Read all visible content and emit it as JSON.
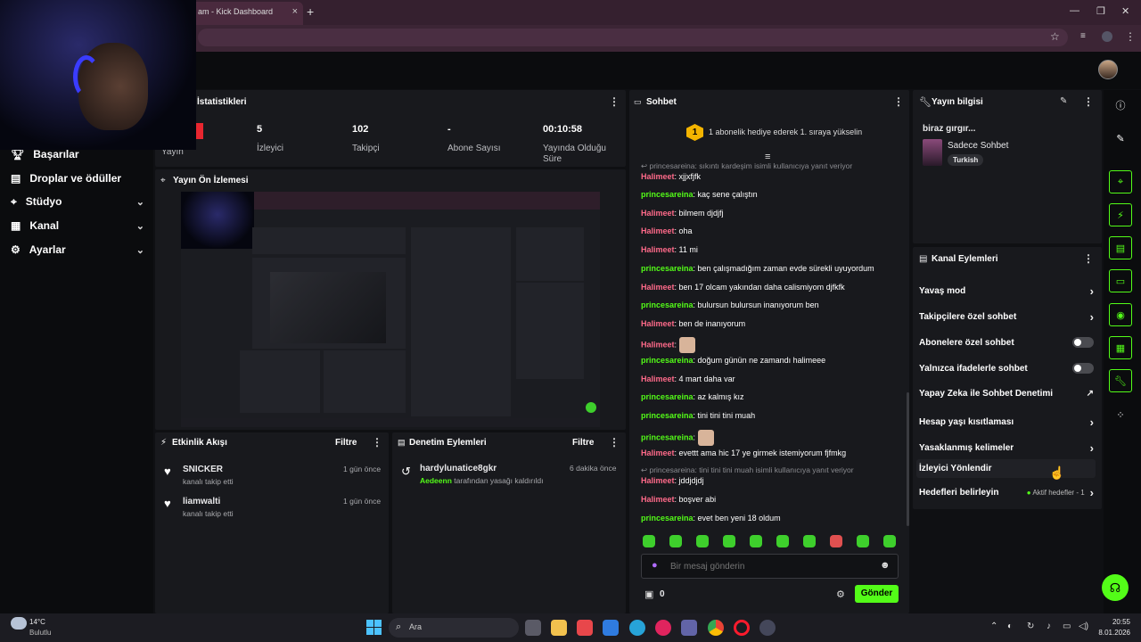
{
  "browser": {
    "tab_title": "am - Kick Dashboard",
    "tab_close": "×",
    "new_tab": "+"
  },
  "sidebar": {
    "items": [
      {
        "label": "Başarılar",
        "icon": "trophy-icon"
      },
      {
        "label": "Droplar ve ödüller",
        "icon": "gift-icon"
      },
      {
        "label": "Stüdyo",
        "icon": "studio-icon",
        "chevron": "⌄"
      },
      {
        "label": "Kanal",
        "icon": "channel-icon",
        "chevron": "⌄"
      },
      {
        "label": "Ayarlar",
        "icon": "gear-icon",
        "chevron": "⌄"
      }
    ]
  },
  "stats": {
    "title": "İstatistikleri",
    "live_label": "Yayın",
    "items": [
      {
        "value": "5",
        "label": "İzleyici"
      },
      {
        "value": "102",
        "label": "Takipçi"
      },
      {
        "value": "-",
        "label": "Abone Sayısı"
      },
      {
        "value": "00:10:58",
        "label": "Yayında Olduğu Süre"
      }
    ]
  },
  "preview": {
    "title": "Yayın Ön İzlemesi"
  },
  "activity": {
    "title": "Etkinlik Akışı",
    "filter": "Filtre",
    "items": [
      {
        "user": "SNICKER",
        "desc": "kanalı takip etti",
        "time": "1 gün önce"
      },
      {
        "user": "liamwalti",
        "desc": "kanalı takip etti",
        "time": "1 gün önce"
      }
    ]
  },
  "moderation": {
    "title": "Denetim Eylemleri",
    "filter": "Filtre",
    "items": [
      {
        "user": "hardylunatice8gkr",
        "actor": "Aedeenn",
        "desc": "tarafından yasağı kaldırıldı",
        "time": "6 dakika önce"
      }
    ]
  },
  "chat": {
    "title": "Sohbet",
    "banner_rank": "1",
    "banner": "1 abonelik hediye ederek 1. sıraya yükselin",
    "reply1": "princesareina: sıkıntı kardeşim isimli kullanıcıya yanıt veriyor",
    "reply2": "princesareina: tini tini tini muah isimli kullanıcıya yanıt veriyor",
    "messages": [
      {
        "user": "Halimeet",
        "text": "xjjxfjfk"
      },
      {
        "user": "princesareina",
        "text": "kaç sene çalıştın"
      },
      {
        "user": "Halimeet",
        "text": "bilmem djdjfj"
      },
      {
        "user": "Halimeet",
        "text": "oha"
      },
      {
        "user": "Halimeet",
        "text": "11 mi"
      },
      {
        "user": "princesareina",
        "text": "ben çalışmadığım zaman evde sürekli uyuyordum"
      },
      {
        "user": "Halimeet",
        "text": "ben 17 olcam yakından daha calismiyom djfkfk"
      },
      {
        "user": "princesareina",
        "text": "bulursun bulursun inanıyorum ben"
      },
      {
        "user": "Halimeet",
        "text": "ben de inanıyorum"
      },
      {
        "user": "Halimeet",
        "text": ""
      },
      {
        "user": "princesareina",
        "text": "doğum günün ne zamandı halimeee"
      },
      {
        "user": "Halimeet",
        "text": "4 mart daha var"
      },
      {
        "user": "princesareina",
        "text": "az kalmış kız"
      },
      {
        "user": "princesareina",
        "text": "tini tini tini muah"
      },
      {
        "user": "princesareina",
        "text": ""
      },
      {
        "user": "Halimeet",
        "text": "evettt ama hic 17 ye girmek istemiyorum fjfmkg"
      },
      {
        "user": "Halimeet",
        "text": "jddjdjdj"
      },
      {
        "user": "Halimeet",
        "text": "boşver abi"
      },
      {
        "user": "princesareina",
        "text": "evet ben yeni 18 oldum"
      }
    ],
    "input_placeholder": "Bir mesaj gönderin",
    "count": "0",
    "send": "Gönder"
  },
  "stream_info": {
    "title": "Yayın bilgisi",
    "stream_title": "biraz gırgır...",
    "category": "Sadece Sohbet",
    "tag": "Turkish"
  },
  "channel_actions": {
    "title": "Kanal Eylemleri",
    "items": [
      {
        "label": "Yavaş mod",
        "control": "arrow"
      },
      {
        "label": "Takipçilere özel sohbet",
        "control": "arrow"
      },
      {
        "label": "Abonelere özel sohbet",
        "control": "toggle"
      },
      {
        "label": "Yalnızca ifadelerle sohbet",
        "control": "toggle"
      },
      {
        "label": "Yapay Zeka ile Sohbet Denetimi",
        "control": "external"
      },
      {
        "label": "Hesap yaşı kısıtlaması",
        "control": "arrow"
      },
      {
        "label": "Yasaklanmış kelimeler",
        "control": "arrow"
      },
      {
        "label": "İzleyici Yönlendir",
        "control": "none"
      },
      {
        "label": "Hedefleri belirleyin",
        "control": "arrow",
        "status": "Aktif hedefler - 1"
      }
    ]
  },
  "taskbar": {
    "weather_temp": "14°C",
    "weather_desc": "Bulutlu",
    "search": "Ara",
    "time": "20:55",
    "date": "8.01.2026"
  },
  "colors": {
    "accent": "#53fc18",
    "bg": "#0f1013",
    "panel": "#18191d",
    "user_pink": "#ff6a8a"
  }
}
